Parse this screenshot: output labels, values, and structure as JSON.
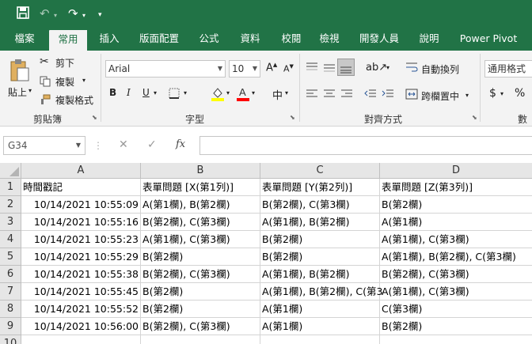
{
  "colors": {
    "accent": "#217346",
    "ribbon": "#f3f3f3"
  },
  "qat": {
    "save_icon": "save-icon",
    "undo_icon": "undo-icon",
    "redo_icon": "redo-icon",
    "customize_icon": "customize-qat-icon"
  },
  "tabs": [
    "檔案",
    "常用",
    "插入",
    "版面配置",
    "公式",
    "資料",
    "校閱",
    "檢視",
    "開發人員",
    "說明",
    "Power Pivot"
  ],
  "active_tab": "常用",
  "clipboard": {
    "paste": "貼上",
    "cut": "剪下",
    "copy": "複製",
    "format_painter": "複製格式",
    "group": "剪貼簿"
  },
  "font": {
    "name": "Arial",
    "size": "10",
    "bold": "B",
    "italic": "I",
    "underline": "U",
    "group": "字型",
    "phonetic": "中"
  },
  "alignment": {
    "wrap_text": "自動換列",
    "merge_center": "跨欄置中",
    "group": "對齊方式"
  },
  "number": {
    "format": "通用格式",
    "currency": "$",
    "percent": "%",
    "group": "數"
  },
  "formula_bar": {
    "name_box": "G34",
    "fx": "fx",
    "cancel": "✕",
    "enter": "✓"
  },
  "columns": [
    "A",
    "B",
    "C",
    "D"
  ],
  "rows": [
    [
      "時間戳記",
      "表單問題 [X(第1列)]",
      "表單問題 [Y(第2列)]",
      "表單問題 [Z(第3列)]"
    ],
    [
      "10/14/2021 10:55:09",
      "A(第1欄), B(第2欄)",
      "B(第2欄), C(第3欄)",
      "B(第2欄)"
    ],
    [
      "10/14/2021 10:55:16",
      "B(第2欄), C(第3欄)",
      "A(第1欄), B(第2欄)",
      "A(第1欄)"
    ],
    [
      "10/14/2021 10:55:23",
      "A(第1欄), C(第3欄)",
      "B(第2欄)",
      "A(第1欄), C(第3欄)"
    ],
    [
      "10/14/2021 10:55:29",
      "B(第2欄)",
      "B(第2欄)",
      "A(第1欄), B(第2欄), C(第3欄)"
    ],
    [
      "10/14/2021 10:55:38",
      "B(第2欄), C(第3欄)",
      "A(第1欄), B(第2欄)",
      "B(第2欄), C(第3欄)"
    ],
    [
      "10/14/2021 10:55:45",
      "B(第2欄)",
      "A(第1欄), B(第2欄), C(第3",
      "A(第1欄), C(第3欄)"
    ],
    [
      "10/14/2021 10:55:52",
      "B(第2欄)",
      "A(第1欄)",
      "C(第3欄)"
    ],
    [
      "10/14/2021 10:56:00",
      "B(第2欄), C(第3欄)",
      "A(第1欄)",
      "B(第2欄)"
    ],
    [
      "",
      "",
      "",
      ""
    ]
  ]
}
